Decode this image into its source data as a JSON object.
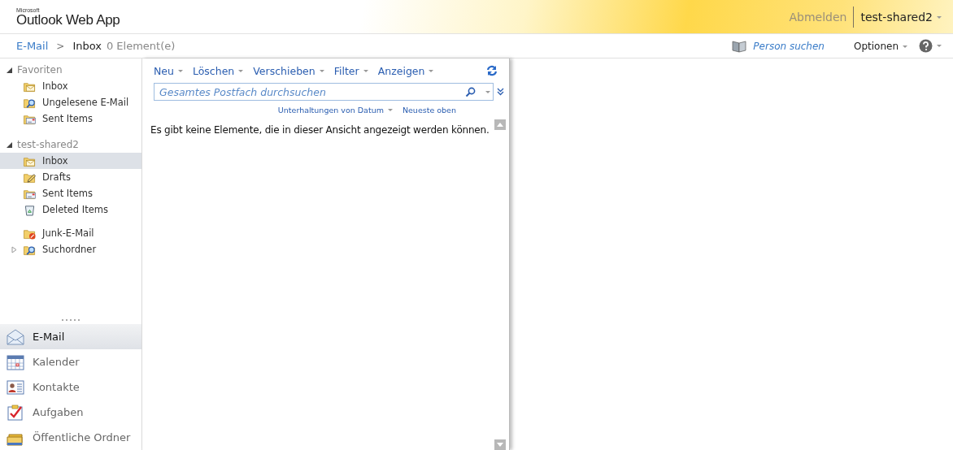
{
  "header": {
    "brand_small": "Microsoft",
    "brand": "Outlook Web App",
    "signout": "Abmelden",
    "user": "test-shared2"
  },
  "breadcrumb": {
    "root": "E-Mail",
    "separator": ">",
    "current": "Inbox",
    "count": "0 Element(e)"
  },
  "tools": {
    "find_person": "Person suchen",
    "options": "Optionen"
  },
  "sections": [
    {
      "title": "Favoriten",
      "expanded": true,
      "groups": [
        [
          {
            "name": "Inbox",
            "kind": "inbox",
            "selected": false,
            "has_children": false
          },
          {
            "name": "Ungelesene E-Mail",
            "kind": "search",
            "selected": false,
            "has_children": false
          },
          {
            "name": "Sent Items",
            "kind": "sent",
            "selected": false,
            "has_children": false
          }
        ]
      ]
    },
    {
      "title": "test-shared2",
      "expanded": true,
      "groups": [
        [
          {
            "name": "Inbox",
            "kind": "inbox",
            "selected": true,
            "has_children": false
          },
          {
            "name": "Drafts",
            "kind": "drafts",
            "selected": false,
            "has_children": false
          },
          {
            "name": "Sent Items",
            "kind": "sent",
            "selected": false,
            "has_children": false
          },
          {
            "name": "Deleted Items",
            "kind": "deleted",
            "selected": false,
            "has_children": false
          }
        ],
        [
          {
            "name": "Junk-E-Mail",
            "kind": "junk",
            "selected": false,
            "has_children": false
          },
          {
            "name": "Suchordner",
            "kind": "search",
            "selected": false,
            "has_children": true
          }
        ]
      ]
    }
  ],
  "nav": [
    {
      "label": "E-Mail",
      "kind": "mail",
      "selected": true
    },
    {
      "label": "Kalender",
      "kind": "calendar",
      "selected": false
    },
    {
      "label": "Kontakte",
      "kind": "contacts",
      "selected": false
    },
    {
      "label": "Aufgaben",
      "kind": "tasks",
      "selected": false
    },
    {
      "label": "Öffentliche Ordner",
      "kind": "public",
      "selected": false
    }
  ],
  "toolbar": [
    "Neu",
    "Löschen",
    "Verschieben",
    "Filter",
    "Anzeigen"
  ],
  "search": {
    "placeholder": "Gesamtes Postfach durchsuchen"
  },
  "sort": {
    "arrange": "Unterhaltungen von Datum",
    "order": "Neueste oben"
  },
  "message": "Es gibt keine Elemente, die in dieser Ansicht angezeigt werden können."
}
